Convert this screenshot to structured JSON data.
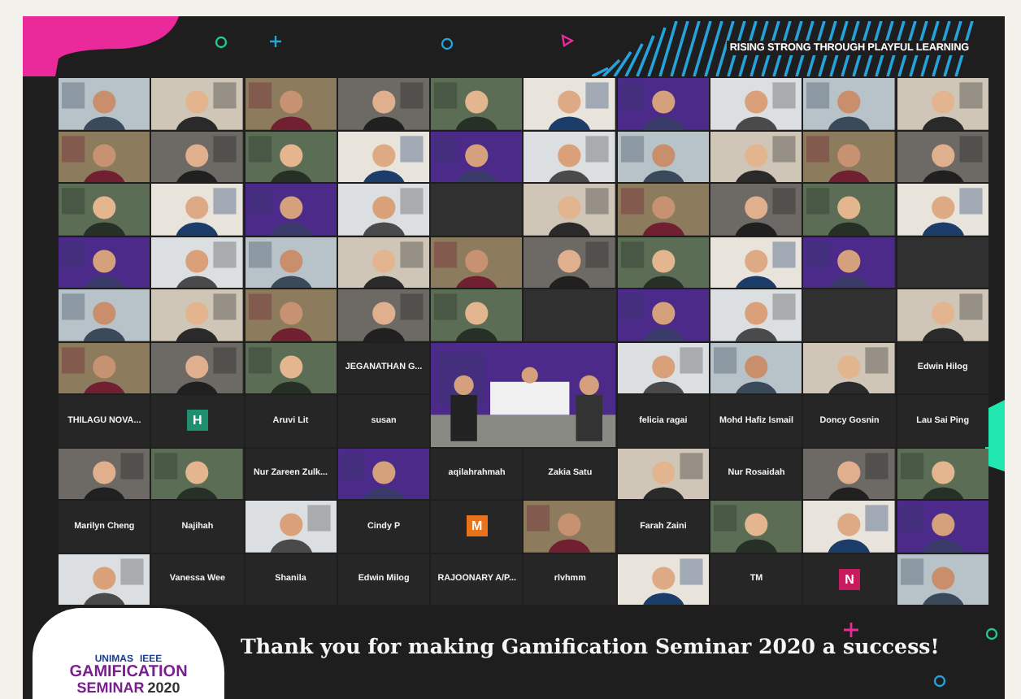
{
  "banner": {
    "tagline": "RISING STRONG THROUGH PLAYFUL LEARNING"
  },
  "gallery": {
    "tiles": [
      {
        "kind": "video"
      },
      {
        "kind": "video"
      },
      {
        "kind": "video"
      },
      {
        "kind": "video"
      },
      {
        "kind": "video"
      },
      {
        "kind": "video"
      },
      {
        "kind": "video"
      },
      {
        "kind": "video"
      },
      {
        "kind": "video"
      },
      {
        "kind": "video"
      },
      {
        "kind": "video"
      },
      {
        "kind": "video"
      },
      {
        "kind": "video"
      },
      {
        "kind": "video"
      },
      {
        "kind": "video"
      },
      {
        "kind": "video"
      },
      {
        "kind": "video"
      },
      {
        "kind": "video"
      },
      {
        "kind": "video"
      },
      {
        "kind": "video"
      },
      {
        "kind": "video"
      },
      {
        "kind": "video"
      },
      {
        "kind": "video"
      },
      {
        "kind": "video"
      },
      {
        "kind": "empty"
      },
      {
        "kind": "video"
      },
      {
        "kind": "video"
      },
      {
        "kind": "video"
      },
      {
        "kind": "video"
      },
      {
        "kind": "video"
      },
      {
        "kind": "video"
      },
      {
        "kind": "video"
      },
      {
        "kind": "video"
      },
      {
        "kind": "video"
      },
      {
        "kind": "video"
      },
      {
        "kind": "video"
      },
      {
        "kind": "video"
      },
      {
        "kind": "video"
      },
      {
        "kind": "video"
      },
      {
        "kind": "empty"
      },
      {
        "kind": "video"
      },
      {
        "kind": "video"
      },
      {
        "kind": "video"
      },
      {
        "kind": "video"
      },
      {
        "kind": "video"
      },
      {
        "kind": "empty"
      },
      {
        "kind": "video"
      },
      {
        "kind": "video"
      },
      {
        "kind": "empty"
      },
      {
        "kind": "video"
      },
      {
        "kind": "video"
      },
      {
        "kind": "video"
      },
      {
        "kind": "video"
      },
      {
        "kind": "name",
        "name": "JEGANATHAN G..."
      },
      {
        "kind": "large"
      },
      {
        "kind": "video"
      },
      {
        "kind": "video"
      },
      {
        "kind": "video"
      },
      {
        "kind": "name",
        "name": "Edwin Hilog"
      },
      {
        "kind": "name",
        "name": "THILAGU NOVA..."
      },
      {
        "kind": "avatar",
        "letter": "H",
        "color": "#1f8f6f"
      },
      {
        "kind": "name",
        "name": "Aruvi Lit"
      },
      {
        "kind": "name",
        "name": "susan"
      },
      {
        "kind": "name",
        "name": "felicia ragai"
      },
      {
        "kind": "name",
        "name": "Mohd Hafiz Ismail"
      },
      {
        "kind": "name",
        "name": "Doncy Gosnin"
      },
      {
        "kind": "name",
        "name": "Lau Sai Ping"
      },
      {
        "kind": "video"
      },
      {
        "kind": "video"
      },
      {
        "kind": "name",
        "name": "Nur Zareen Zulk..."
      },
      {
        "kind": "video"
      },
      {
        "kind": "name",
        "name": "aqilahrahmah"
      },
      {
        "kind": "name",
        "name": "Zakia Satu"
      },
      {
        "kind": "video"
      },
      {
        "kind": "name",
        "name": "Nur Rosaidah"
      },
      {
        "kind": "video"
      },
      {
        "kind": "video"
      },
      {
        "kind": "name",
        "name": "Marilyn Cheng"
      },
      {
        "kind": "name",
        "name": "Najihah"
      },
      {
        "kind": "video"
      },
      {
        "kind": "name",
        "name": "Cindy P"
      },
      {
        "kind": "avatar",
        "letter": "M",
        "color": "#e8731a"
      },
      {
        "kind": "video"
      },
      {
        "kind": "name",
        "name": "Farah Zaini"
      },
      {
        "kind": "video"
      },
      {
        "kind": "video"
      },
      {
        "kind": "video"
      },
      {
        "kind": "video"
      },
      {
        "kind": "name",
        "name": "Vanessa Wee"
      },
      {
        "kind": "name",
        "name": "Shanila"
      },
      {
        "kind": "name",
        "name": "Edwin Milog"
      },
      {
        "kind": "name",
        "name": "RAJOONARY A/P..."
      },
      {
        "kind": "name",
        "name": "rlvhmm"
      },
      {
        "kind": "video"
      },
      {
        "kind": "name",
        "name": "TM"
      },
      {
        "kind": "avatar",
        "letter": "N",
        "color": "#c81a5e"
      },
      {
        "kind": "video"
      }
    ]
  },
  "footer": {
    "logo": {
      "partners": [
        "UNIMAS",
        "IEEE"
      ],
      "title": "GAMIFICATION",
      "subtitle": "SEMINAR",
      "year": "2020"
    },
    "message": "Thank you for making Gamification Seminar 2020 a success!"
  }
}
